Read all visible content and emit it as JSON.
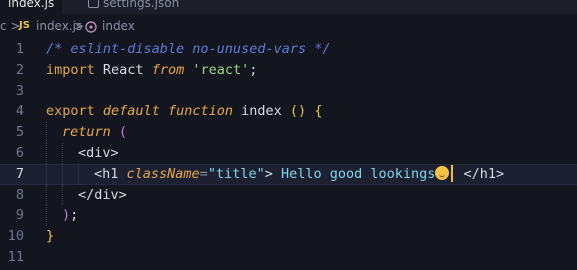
{
  "tabs": [
    {
      "label": "index.js"
    },
    {
      "label": "settings.json"
    }
  ],
  "breadcrumb": {
    "lead": "c",
    "sep": ">",
    "js_badge": "JS",
    "file": "index.js",
    "symbol": "index"
  },
  "editor": {
    "current_line": 7,
    "lines": [
      {
        "n": "1",
        "tokens": [
          {
            "c": "t-comment",
            "t": "/* eslint-disable no-unused-vars */"
          }
        ]
      },
      {
        "n": "2",
        "tokens": [
          {
            "c": "t-keyword",
            "t": "import"
          },
          {
            "c": "t-fn",
            "t": " React "
          },
          {
            "c": "t-italic",
            "t": "from"
          },
          {
            "c": "t-fn",
            "t": " "
          },
          {
            "c": "t-string",
            "t": "'react'"
          },
          {
            "c": "t-fn",
            "t": ";"
          }
        ]
      },
      {
        "n": "3",
        "tokens": []
      },
      {
        "n": "4",
        "tokens": [
          {
            "c": "t-keyword",
            "t": "export"
          },
          {
            "c": "t-fn",
            "t": " "
          },
          {
            "c": "t-italic",
            "t": "default"
          },
          {
            "c": "t-fn",
            "t": " "
          },
          {
            "c": "t-italic",
            "t": "function"
          },
          {
            "c": "t-fn",
            "t": " index "
          },
          {
            "c": "t-paren",
            "t": "()"
          },
          {
            "c": "t-fn",
            "t": " "
          },
          {
            "c": "t-paren",
            "t": "{"
          }
        ]
      },
      {
        "n": "5",
        "tokens": [
          {
            "c": "t-italic",
            "t": "return"
          },
          {
            "c": "t-fn",
            "t": " "
          },
          {
            "c": "t-paren2",
            "t": "("
          }
        ]
      },
      {
        "n": "6",
        "tokens": [
          {
            "c": "t-tag",
            "t": "<div>"
          }
        ]
      },
      {
        "n": "7",
        "tokens": [
          {
            "c": "t-tag",
            "t": "<h1 "
          },
          {
            "c": "t-attr",
            "t": "className"
          },
          {
            "c": "t-op",
            "t": "="
          },
          {
            "c": "t-attrval",
            "t": "\"title\""
          },
          {
            "c": "t-tag",
            "t": "> "
          },
          {
            "c": "t-text",
            "t": "Hello good lookings"
          },
          {
            "c": "emoji",
            "t": ""
          },
          {
            "c": "cursor",
            "t": ""
          },
          {
            "c": "t-tag",
            "t": " </h1>"
          }
        ]
      },
      {
        "n": "8",
        "tokens": [
          {
            "c": "t-tag",
            "t": "</div>"
          }
        ]
      },
      {
        "n": "9",
        "tokens": [
          {
            "c": "t-paren2",
            "t": ")"
          },
          {
            "c": "t-fn",
            "t": ";"
          }
        ]
      },
      {
        "n": "10",
        "tokens": [
          {
            "c": "t-paren",
            "t": "}"
          }
        ]
      },
      {
        "n": "11",
        "tokens": []
      }
    ],
    "indents": [
      0,
      0,
      0,
      0,
      1,
      2,
      3,
      2,
      1,
      0,
      0
    ]
  }
}
